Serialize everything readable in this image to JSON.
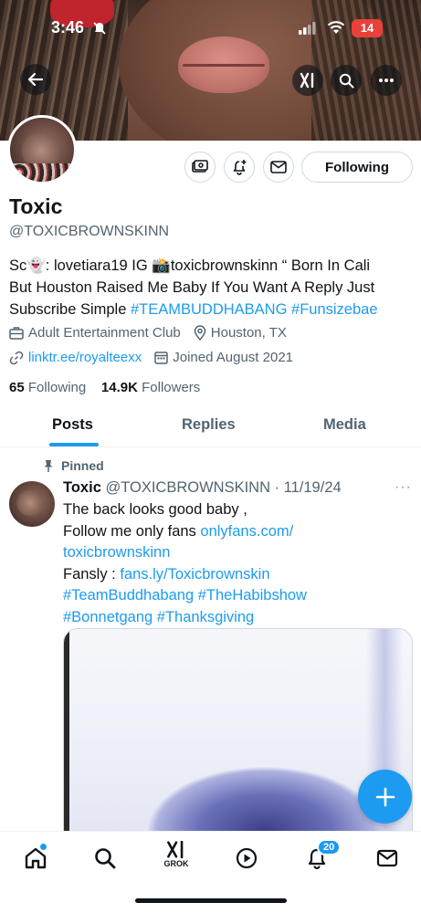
{
  "status_bar": {
    "time": "3:46",
    "battery": "14"
  },
  "profile": {
    "name": "Toxic",
    "handle": "@TOXICBROWNSKINN",
    "following_button": "Following",
    "bio": {
      "line1": "Sc👻: lovetiara19 IG 📸toxicbrownskinn “ Born In Cali",
      "line2": "But Houston Raised Me Baby If You Want A Reply Just",
      "line3_text": "Subscribe Simple ",
      "hashtag1": "#TEAMBUDDHABANG",
      "hashtag2": "#Funsizebae"
    },
    "category": "Adult Entertainment Club",
    "location": "Houston, TX",
    "website": "linktr.ee/royalteexx",
    "joined": "Joined August 2021",
    "following_count": "65",
    "following_label": "Following",
    "followers_count": "14.9K",
    "followers_label": "Followers"
  },
  "tabs": [
    {
      "label": "Posts"
    },
    {
      "label": "Replies"
    },
    {
      "label": "Media"
    }
  ],
  "post": {
    "pinned_label": "Pinned",
    "author_name": "Toxic",
    "author_handle_date": "@TOXICBROWNSKINN · 11/19/24",
    "more": "···",
    "line1": "The back looks good baby ,",
    "line2_text": "Follow me only fans ",
    "line2_link": "onlyfans.com/",
    "line3_link": "toxicbrownskinn",
    "line4_text": "Fansly : ",
    "line4_link": "fans.ly/Toxicbrownskin",
    "line5_tag1": "#TeamBuddhabang",
    "line5_tag2": "#TheHabibshow",
    "line6_tag1": "#Bonnetgang",
    "line6_tag2": "#Thanksgiving"
  },
  "bottom_nav": {
    "grok_label": "GROK",
    "notification_badge": "20"
  },
  "colors": {
    "accent": "#1d9bf0",
    "text": "#0f1419",
    "muted": "#536471"
  }
}
